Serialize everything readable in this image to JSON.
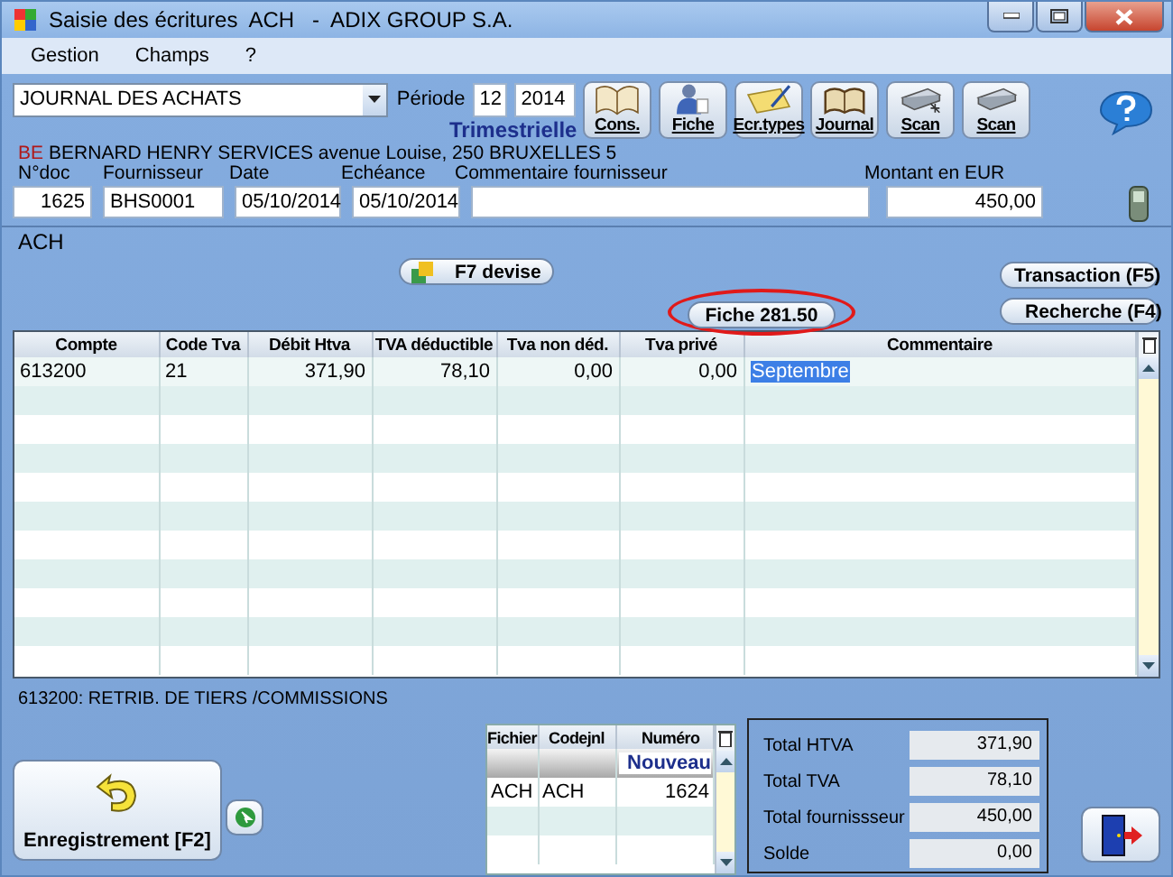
{
  "window": {
    "title": "Saisie des écritures  ACH   -  ADIX GROUP S.A."
  },
  "menu": [
    {
      "label": "Gestion"
    },
    {
      "label": "Champs"
    },
    {
      "label": "?"
    }
  ],
  "journal": {
    "value": "JOURNAL DES ACHATS"
  },
  "period": {
    "label": "Période",
    "month": "12",
    "year": "2014",
    "frequency": "Trimestrielle"
  },
  "toolbar": [
    {
      "label": "Cons.",
      "kind": "book"
    },
    {
      "label": "Fiche",
      "kind": "person"
    },
    {
      "label": "Ecr.types",
      "kind": "notepad"
    },
    {
      "label": "Journal",
      "kind": "ledger"
    },
    {
      "label": "Scan",
      "kind": "scanner-plus"
    },
    {
      "label": "Scan",
      "kind": "scanner"
    }
  ],
  "supplier_line": {
    "country": "BE",
    "text": "BERNARD HENRY SERVICES avenue Louise, 250 BRUXELLES 5"
  },
  "fields": [
    {
      "label": "N°doc",
      "value": "1625",
      "kind": "number"
    },
    {
      "label": "Fournisseur",
      "value": "BHS0001",
      "kind": "text"
    },
    {
      "label": "Date",
      "value": "05/10/2014",
      "kind": "text"
    },
    {
      "label": "Echéance",
      "value": "05/10/2014",
      "kind": "text"
    },
    {
      "label": "Commentaire fournisseur",
      "kind": "text"
    },
    {
      "label": "Montant en EUR",
      "value": "450,00",
      "kind": "number"
    }
  ],
  "section_title": "ACH",
  "actions": {
    "devise": "F7 devise",
    "fiche": {
      "label": "Fiche 281.50",
      "highlighted": true
    },
    "transaction": "Transaction (F5)",
    "recherche": "Recherche (F4)"
  },
  "table": {
    "columns": [
      "Compte",
      "Code Tva",
      "Débit Htva",
      "TVA déductible",
      "Tva non déd.",
      "Tva privé",
      "Commentaire"
    ],
    "rows": [
      {
        "cells": [
          {
            "text": "613200",
            "selected": false
          },
          {
            "text": "21",
            "selected": false
          },
          {
            "text": "371,90",
            "selected": false
          },
          {
            "text": "78,10",
            "selected": false
          },
          {
            "text": "0,00",
            "selected": false
          },
          {
            "text": "0,00",
            "selected": false
          },
          {
            "text": "Septembre",
            "selected": true
          }
        ]
      }
    ]
  },
  "account_info": "613200: RETRIB. DE TIERS /COMMISSIONS",
  "save_button": "Enregistrement [F2]",
  "files": {
    "columns": [
      "Fichier",
      "Codejnl",
      "Numéro"
    ],
    "new_label": "Nouveau",
    "rows": [
      [
        "ACH",
        "ACH",
        "1624"
      ]
    ]
  },
  "totals": [
    {
      "label": "Total HTVA",
      "value": "371,90"
    },
    {
      "label": "Total TVA",
      "value": "78,10"
    },
    {
      "label": "Total fournissseur",
      "value": "450,00"
    },
    {
      "label": "Solde",
      "value": "0,00"
    }
  ]
}
